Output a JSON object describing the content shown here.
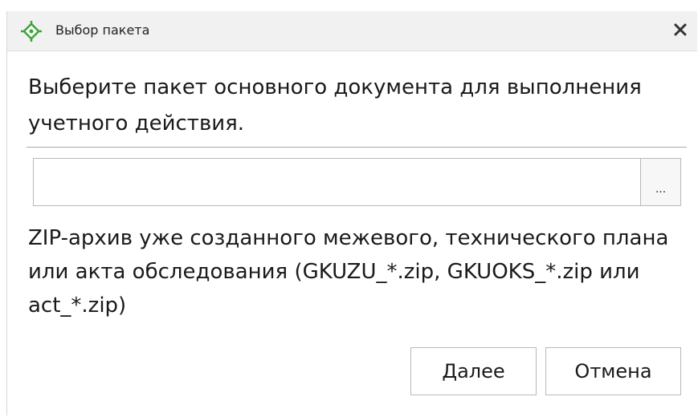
{
  "window": {
    "title": "Выбор пакета",
    "icon": "crosshair-target-icon",
    "accent_color": "#3aa63a",
    "close_glyph": "✕"
  },
  "main": {
    "instruction": "Выберите пакет основного документа для выполнения учетного действия.",
    "file_input": {
      "value": "",
      "browse_label": "..."
    },
    "hint": "ZIP-архив уже созданного межевого, технического плана или акта обследования (GKUZU_*.zip, GKUOKS_*.zip или act_*.zip)"
  },
  "buttons": {
    "next_label": "Далее",
    "cancel_label": "Отмена"
  }
}
